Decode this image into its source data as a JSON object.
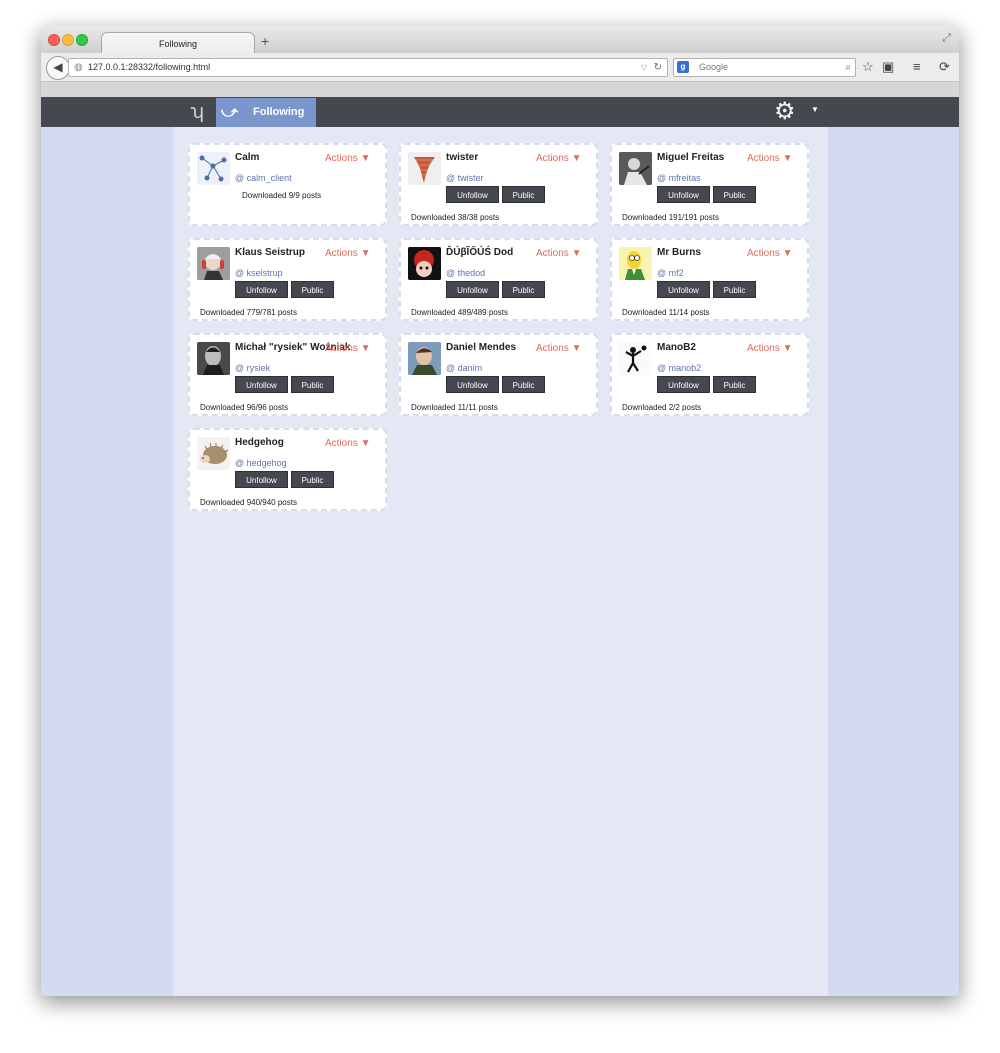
{
  "browser": {
    "tab_title": "Following",
    "new_tab": "+",
    "url": "127.0.0.1:28332/following.html",
    "search_placeholder": "Google"
  },
  "app": {
    "nav_tab_label": "Following"
  },
  "cards": [
    {
      "name": "Calm",
      "handle": "@ calm_client",
      "actions": "Actions ▼",
      "downloaded": "Downloaded 9/9 posts",
      "show_buttons": false
    },
    {
      "name": "twister",
      "handle": "@ twister",
      "actions": "Actions ▼",
      "unfollow": "Unfollow",
      "public": "Public",
      "downloaded": "Downloaded 38/38 posts"
    },
    {
      "name": "Miguel Freitas",
      "handle": "@ mfreitas",
      "actions": "Actions ▼",
      "unfollow": "Unfollow",
      "public": "Public",
      "downloaded": "Downloaded 191/191 posts"
    },
    {
      "name": "Klaus Seistrup",
      "handle": "@ kseistrup",
      "actions": "Actions ▼",
      "unfollow": "Unfollow",
      "public": "Public",
      "downloaded": "Downloaded 779/781 posts"
    },
    {
      "name": "ĎÚβĨŐÚŚ Dod",
      "handle": "@ thedod",
      "actions": "Actions ▼",
      "unfollow": "Unfollow",
      "public": "Public",
      "downloaded": "Downloaded 489/489 posts"
    },
    {
      "name": "Mr Burns",
      "handle": "@ mf2",
      "actions": "Actions ▼",
      "unfollow": "Unfollow",
      "public": "Public",
      "downloaded": "Downloaded 11/14 posts"
    },
    {
      "name": "Michał \"rysiek\" Woźniak",
      "handle": "@ rysiek",
      "actions": "Actions ▼",
      "unfollow": "Unfollow",
      "public": "Public",
      "downloaded": "Downloaded 96/96 posts"
    },
    {
      "name": "Daniel Mendes",
      "handle": "@ danim",
      "actions": "Actions ▼",
      "unfollow": "Unfollow",
      "public": "Public",
      "downloaded": "Downloaded 11/11 posts"
    },
    {
      "name": "ManoB2",
      "handle": "@ manob2",
      "actions": "Actions ▼",
      "unfollow": "Unfollow",
      "public": "Public",
      "downloaded": "Downloaded 2/2 posts"
    },
    {
      "name": "Hedgehog",
      "handle": "@ hedgehog",
      "actions": "Actions ▼",
      "unfollow": "Unfollow",
      "public": "Public",
      "downloaded": "Downloaded 940/940 posts"
    }
  ],
  "colors": {
    "accent": "#7b96cc",
    "header": "#45484f",
    "actions": "#de6b5f",
    "handle": "#5d75a8"
  },
  "icons": {
    "logo": "twister-logo-icon",
    "following": "following-icon",
    "settings": "gear-icon"
  }
}
